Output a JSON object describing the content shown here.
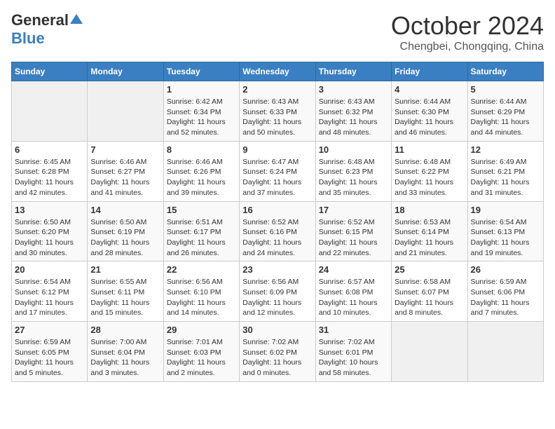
{
  "header": {
    "logo_general": "General",
    "logo_blue": "Blue",
    "month": "October 2024",
    "location": "Chengbei, Chongqing, China"
  },
  "weekdays": [
    "Sunday",
    "Monday",
    "Tuesday",
    "Wednesday",
    "Thursday",
    "Friday",
    "Saturday"
  ],
  "weeks": [
    [
      {
        "date": "",
        "sunrise": "",
        "sunset": "",
        "daylight": ""
      },
      {
        "date": "",
        "sunrise": "",
        "sunset": "",
        "daylight": ""
      },
      {
        "date": "1",
        "sunrise": "Sunrise: 6:42 AM",
        "sunset": "Sunset: 6:34 PM",
        "daylight": "Daylight: 11 hours and 52 minutes."
      },
      {
        "date": "2",
        "sunrise": "Sunrise: 6:43 AM",
        "sunset": "Sunset: 6:33 PM",
        "daylight": "Daylight: 11 hours and 50 minutes."
      },
      {
        "date": "3",
        "sunrise": "Sunrise: 6:43 AM",
        "sunset": "Sunset: 6:32 PM",
        "daylight": "Daylight: 11 hours and 48 minutes."
      },
      {
        "date": "4",
        "sunrise": "Sunrise: 6:44 AM",
        "sunset": "Sunset: 6:30 PM",
        "daylight": "Daylight: 11 hours and 46 minutes."
      },
      {
        "date": "5",
        "sunrise": "Sunrise: 6:44 AM",
        "sunset": "Sunset: 6:29 PM",
        "daylight": "Daylight: 11 hours and 44 minutes."
      }
    ],
    [
      {
        "date": "6",
        "sunrise": "Sunrise: 6:45 AM",
        "sunset": "Sunset: 6:28 PM",
        "daylight": "Daylight: 11 hours and 42 minutes."
      },
      {
        "date": "7",
        "sunrise": "Sunrise: 6:46 AM",
        "sunset": "Sunset: 6:27 PM",
        "daylight": "Daylight: 11 hours and 41 minutes."
      },
      {
        "date": "8",
        "sunrise": "Sunrise: 6:46 AM",
        "sunset": "Sunset: 6:26 PM",
        "daylight": "Daylight: 11 hours and 39 minutes."
      },
      {
        "date": "9",
        "sunrise": "Sunrise: 6:47 AM",
        "sunset": "Sunset: 6:24 PM",
        "daylight": "Daylight: 11 hours and 37 minutes."
      },
      {
        "date": "10",
        "sunrise": "Sunrise: 6:48 AM",
        "sunset": "Sunset: 6:23 PM",
        "daylight": "Daylight: 11 hours and 35 minutes."
      },
      {
        "date": "11",
        "sunrise": "Sunrise: 6:48 AM",
        "sunset": "Sunset: 6:22 PM",
        "daylight": "Daylight: 11 hours and 33 minutes."
      },
      {
        "date": "12",
        "sunrise": "Sunrise: 6:49 AM",
        "sunset": "Sunset: 6:21 PM",
        "daylight": "Daylight: 11 hours and 31 minutes."
      }
    ],
    [
      {
        "date": "13",
        "sunrise": "Sunrise: 6:50 AM",
        "sunset": "Sunset: 6:20 PM",
        "daylight": "Daylight: 11 hours and 30 minutes."
      },
      {
        "date": "14",
        "sunrise": "Sunrise: 6:50 AM",
        "sunset": "Sunset: 6:19 PM",
        "daylight": "Daylight: 11 hours and 28 minutes."
      },
      {
        "date": "15",
        "sunrise": "Sunrise: 6:51 AM",
        "sunset": "Sunset: 6:17 PM",
        "daylight": "Daylight: 11 hours and 26 minutes."
      },
      {
        "date": "16",
        "sunrise": "Sunrise: 6:52 AM",
        "sunset": "Sunset: 6:16 PM",
        "daylight": "Daylight: 11 hours and 24 minutes."
      },
      {
        "date": "17",
        "sunrise": "Sunrise: 6:52 AM",
        "sunset": "Sunset: 6:15 PM",
        "daylight": "Daylight: 11 hours and 22 minutes."
      },
      {
        "date": "18",
        "sunrise": "Sunrise: 6:53 AM",
        "sunset": "Sunset: 6:14 PM",
        "daylight": "Daylight: 11 hours and 21 minutes."
      },
      {
        "date": "19",
        "sunrise": "Sunrise: 6:54 AM",
        "sunset": "Sunset: 6:13 PM",
        "daylight": "Daylight: 11 hours and 19 minutes."
      }
    ],
    [
      {
        "date": "20",
        "sunrise": "Sunrise: 6:54 AM",
        "sunset": "Sunset: 6:12 PM",
        "daylight": "Daylight: 11 hours and 17 minutes."
      },
      {
        "date": "21",
        "sunrise": "Sunrise: 6:55 AM",
        "sunset": "Sunset: 6:11 PM",
        "daylight": "Daylight: 11 hours and 15 minutes."
      },
      {
        "date": "22",
        "sunrise": "Sunrise: 6:56 AM",
        "sunset": "Sunset: 6:10 PM",
        "daylight": "Daylight: 11 hours and 14 minutes."
      },
      {
        "date": "23",
        "sunrise": "Sunrise: 6:56 AM",
        "sunset": "Sunset: 6:09 PM",
        "daylight": "Daylight: 11 hours and 12 minutes."
      },
      {
        "date": "24",
        "sunrise": "Sunrise: 6:57 AM",
        "sunset": "Sunset: 6:08 PM",
        "daylight": "Daylight: 11 hours and 10 minutes."
      },
      {
        "date": "25",
        "sunrise": "Sunrise: 6:58 AM",
        "sunset": "Sunset: 6:07 PM",
        "daylight": "Daylight: 11 hours and 8 minutes."
      },
      {
        "date": "26",
        "sunrise": "Sunrise: 6:59 AM",
        "sunset": "Sunset: 6:06 PM",
        "daylight": "Daylight: 11 hours and 7 minutes."
      }
    ],
    [
      {
        "date": "27",
        "sunrise": "Sunrise: 6:59 AM",
        "sunset": "Sunset: 6:05 PM",
        "daylight": "Daylight: 11 hours and 5 minutes."
      },
      {
        "date": "28",
        "sunrise": "Sunrise: 7:00 AM",
        "sunset": "Sunset: 6:04 PM",
        "daylight": "Daylight: 11 hours and 3 minutes."
      },
      {
        "date": "29",
        "sunrise": "Sunrise: 7:01 AM",
        "sunset": "Sunset: 6:03 PM",
        "daylight": "Daylight: 11 hours and 2 minutes."
      },
      {
        "date": "30",
        "sunrise": "Sunrise: 7:02 AM",
        "sunset": "Sunset: 6:02 PM",
        "daylight": "Daylight: 11 hours and 0 minutes."
      },
      {
        "date": "31",
        "sunrise": "Sunrise: 7:02 AM",
        "sunset": "Sunset: 6:01 PM",
        "daylight": "Daylight: 10 hours and 58 minutes."
      },
      {
        "date": "",
        "sunrise": "",
        "sunset": "",
        "daylight": ""
      },
      {
        "date": "",
        "sunrise": "",
        "sunset": "",
        "daylight": ""
      }
    ]
  ]
}
